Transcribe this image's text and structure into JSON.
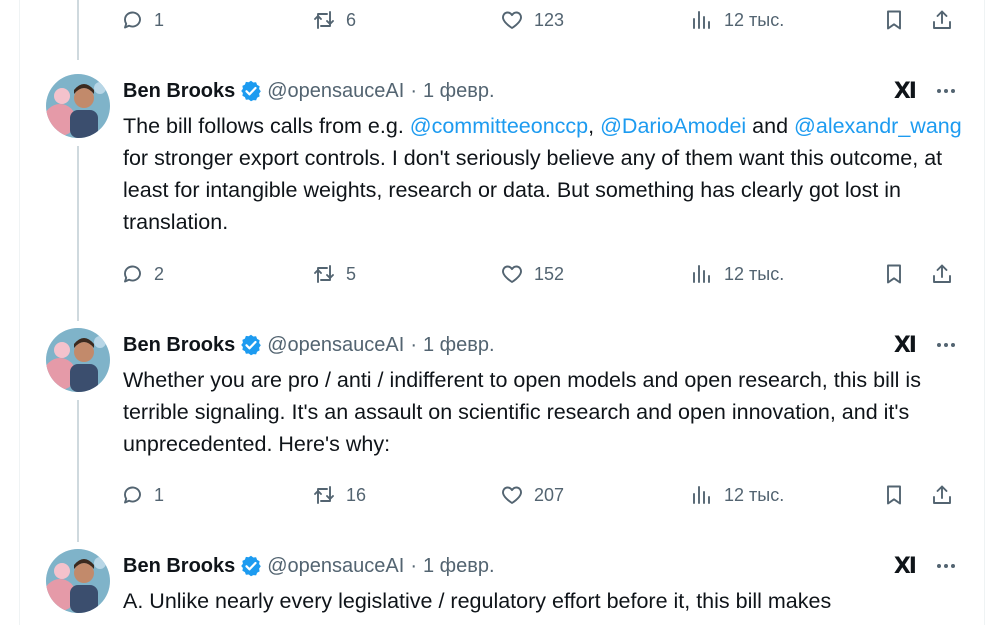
{
  "actions_row_0": {
    "reply": "1",
    "retweet": "6",
    "like": "123",
    "views": "12 тыс."
  },
  "tweets": [
    {
      "author": "Ben Brooks",
      "handle": "@opensauceAI",
      "sep": "·",
      "date": "1 февр.",
      "badge": "XI",
      "text_parts": {
        "p1": "The bill follows calls from e.g. ",
        "m1": "@committeeonccp",
        "p2": ", ",
        "m2": "@DarioAmodei",
        "p3": " and ",
        "m3": "@alexandr_wang",
        "p4": " for stronger export controls. I don't seriously believe any of them want this outcome, at least for intangible weights, research or data. But something has clearly got lost in translation."
      },
      "reply": "2",
      "retweet": "5",
      "like": "152",
      "views": "12 тыс."
    },
    {
      "author": "Ben Brooks",
      "handle": "@opensauceAI",
      "sep": "·",
      "date": "1 февр.",
      "badge": "XI",
      "text": "Whether you are pro / anti / indifferent to open models and open research, this bill is terrible signaling. It's an assault on scientific research and open innovation, and it's unprecedented. Here's why:",
      "reply": "1",
      "retweet": "16",
      "like": "207",
      "views": "12 тыс."
    },
    {
      "author": "Ben Brooks",
      "handle": "@opensauceAI",
      "sep": "·",
      "date": "1 февр.",
      "badge": "XI",
      "text": "A. Unlike nearly every legislative / regulatory effort before it, this bill makes"
    }
  ],
  "colors": {
    "accent": "#1d9bf0",
    "text": "#0f1419",
    "muted": "#536471",
    "line": "#cfd9de"
  },
  "icons": [
    "reply-icon",
    "retweet-icon",
    "like-icon",
    "views-icon",
    "bookmark-icon",
    "share-icon",
    "verified-icon",
    "more-icon"
  ]
}
